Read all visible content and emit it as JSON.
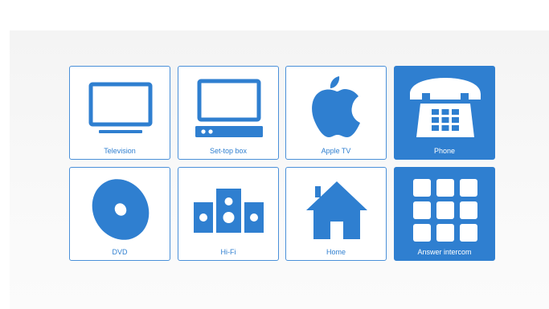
{
  "tiles": [
    {
      "label": "Television",
      "icon": "tv-icon",
      "active": false
    },
    {
      "label": "Set-top box",
      "icon": "set-top-box-icon",
      "active": false
    },
    {
      "label": "Apple TV",
      "icon": "apple-icon",
      "active": false
    },
    {
      "label": "Phone",
      "icon": "phone-icon",
      "active": true
    },
    {
      "label": "DVD",
      "icon": "dvd-icon",
      "active": false
    },
    {
      "label": "Hi-Fi",
      "icon": "hifi-icon",
      "active": false
    },
    {
      "label": "Home",
      "icon": "home-icon",
      "active": false
    },
    {
      "label": "Answer intercom",
      "icon": "keypad-icon",
      "active": true
    }
  ],
  "colors": {
    "accent": "#2f7fd0",
    "tile_border": "#4a90d9",
    "tile_bg": "#ffffff",
    "panel_bg": "#f6f6f6"
  }
}
